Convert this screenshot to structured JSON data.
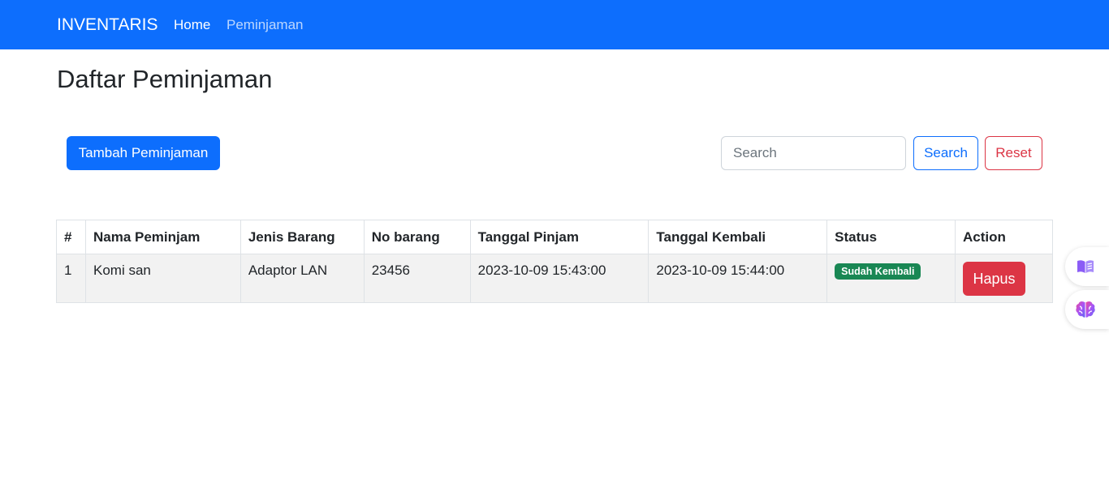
{
  "navbar": {
    "brand": "INVENTARIS",
    "links": [
      "Home",
      "Peminjaman"
    ]
  },
  "page": {
    "title": "Daftar Peminjaman"
  },
  "toolbar": {
    "add_label": "Tambah Peminjaman",
    "search_placeholder": "Search",
    "search_value": "",
    "search_label": "Search",
    "reset_label": "Reset"
  },
  "table": {
    "headers": [
      "#",
      "Nama Peminjam",
      "Jenis Barang",
      "No barang",
      "Tanggal Pinjam",
      "Tanggal Kembali",
      "Status",
      "Action"
    ],
    "rows": [
      {
        "no": "1",
        "nama": "Komi san",
        "jenis": "Adaptor LAN",
        "no_barang": "23456",
        "tgl_pinjam": "2023-10-09 15:43:00",
        "tgl_kembali": "2023-10-09 15:44:00",
        "status": "Sudah Kembali",
        "action": "Hapus"
      }
    ]
  },
  "floating": {
    "icons": [
      "book-icon",
      "brain-icon"
    ]
  },
  "colors": {
    "primary": "#0d6efd",
    "danger": "#dc3545",
    "success": "#198754"
  }
}
